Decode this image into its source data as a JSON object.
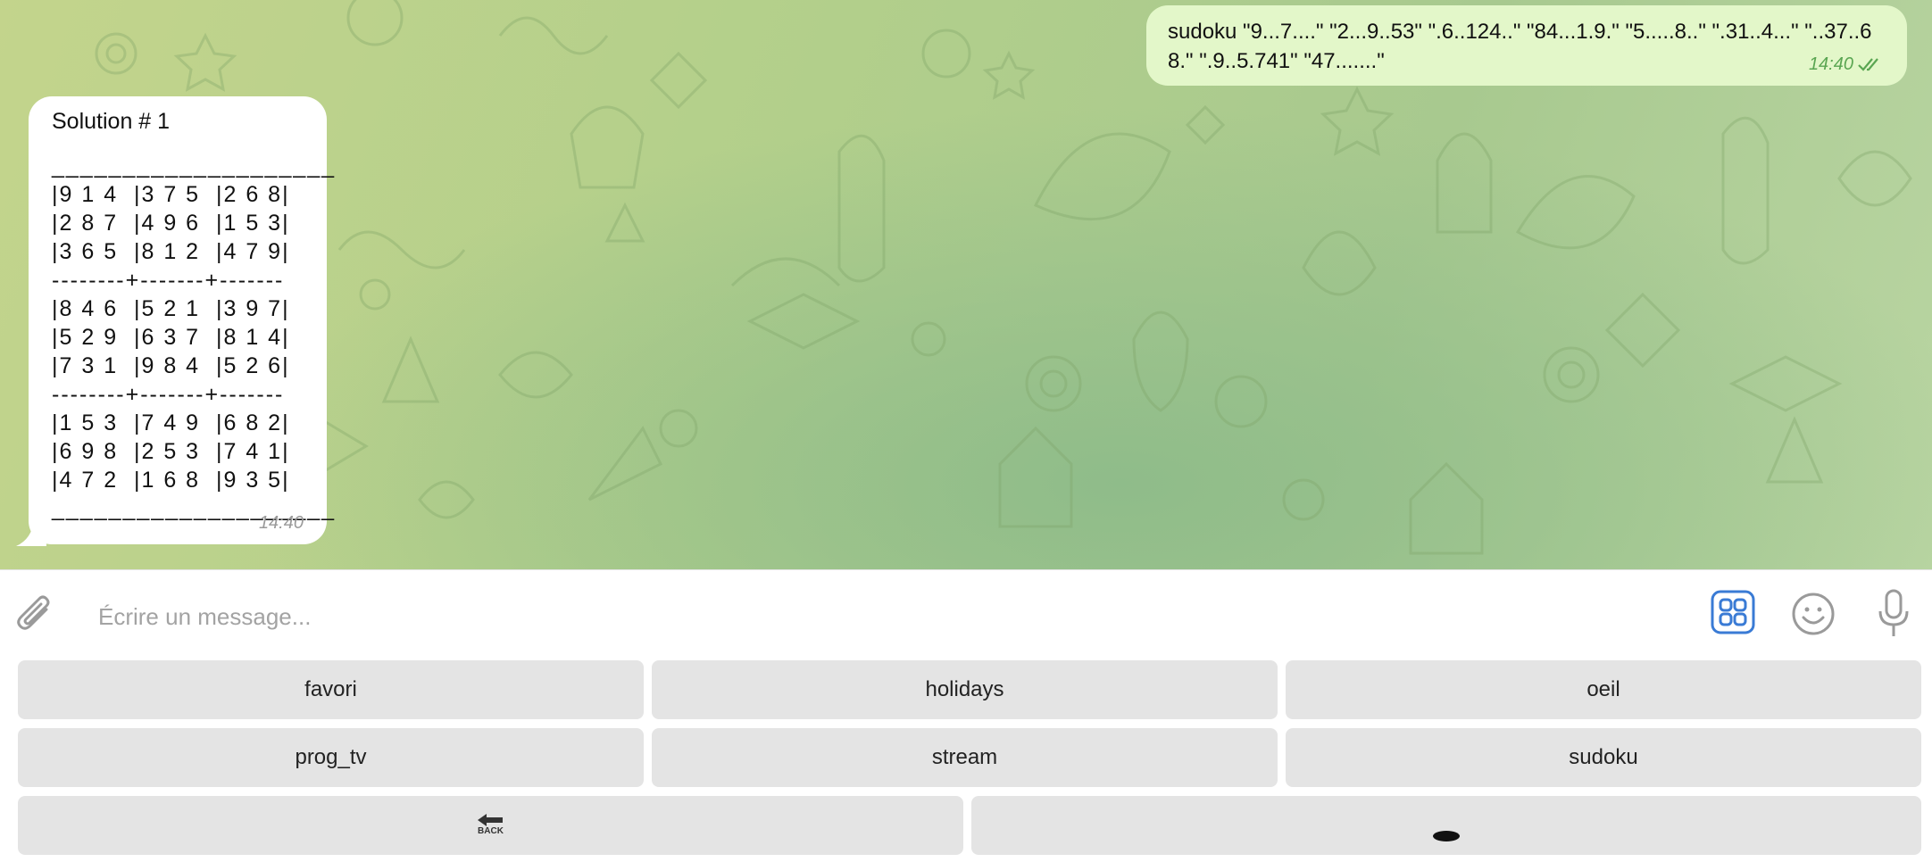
{
  "chat": {
    "outgoing": {
      "text": "sudoku \"9...7....\" \"2...9..53\" \".6..124..\" \"84...1.9.\" \"5.....8..\" \".31..4...\" \"..37..68.\" \".9..5.741\" \"47.......\"",
      "time": "14:40"
    },
    "incoming": {
      "title": "Solution # 1",
      "grid_lines": [
        "____________________",
        "|9 1 4  |3 7 5  |2 6 8|",
        "|2 8 7  |4 9 6  |1 5 3|",
        "|3 6 5  |8 1 2  |4 7 9|",
        "--------+-------+-------",
        "|8 4 6  |5 2 1  |3 9 7|",
        "|5 2 9  |6 3 7  |8 1 4|",
        "|7 3 1  |9 8 4  |5 2 6|",
        "--------+-------+-------",
        "|1 5 3  |7 4 9  |6 8 2|",
        "|6 9 8  |2 5 3  |7 4 1|",
        "|4 7 2  |1 6 8  |9 3 5|",
        "____________________"
      ],
      "time": "14:40"
    }
  },
  "composer": {
    "placeholder": "Écrire un message...",
    "value": ""
  },
  "keyboard": {
    "row1": [
      "favori",
      "holidays",
      "oeil"
    ],
    "row2": [
      "prog_tv",
      "stream",
      "sudoku"
    ],
    "back_label": "BACK"
  },
  "icons": {
    "attach": "paperclip-icon",
    "bot_menu": "bot-commands-icon",
    "emoji": "emoji-icon",
    "mic": "microphone-icon"
  },
  "colors": {
    "accent": "#3a7bd5",
    "outgoing_bubble": "#e3f7c9",
    "incoming_bubble": "#ffffff",
    "read_ticks": "#5aa652",
    "key_bg": "#e4e4e4"
  }
}
